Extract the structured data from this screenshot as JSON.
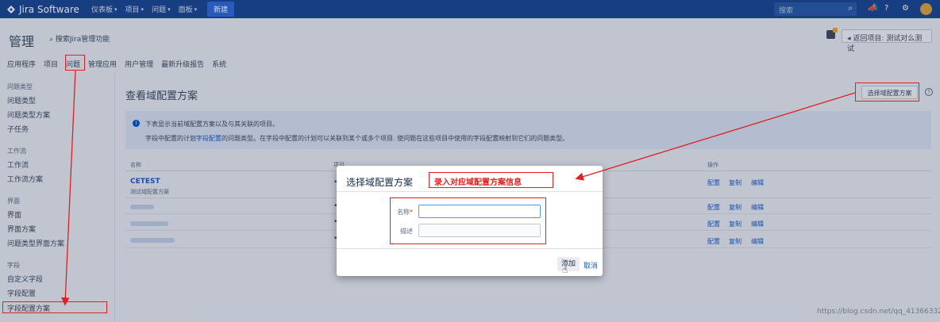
{
  "topbar": {
    "logo": "Jira Software",
    "nav": [
      "仪表板",
      "项目",
      "问题",
      "面板"
    ],
    "create": "新建",
    "search_placeholder": "搜索",
    "icons": [
      "search-icon",
      "notifications-icon",
      "help-icon",
      "settings-icon",
      "avatar"
    ]
  },
  "header": {
    "title": "管理",
    "search_admin": "搜索Jira管理功能",
    "back": "返回项目: 测试对么测试",
    "tabs": [
      "应用程序",
      "项目",
      "问题",
      "管理应用",
      "用户管理",
      "最新升级报告",
      "系统"
    ]
  },
  "sidebar": {
    "groups": [
      {
        "title": "问题类型",
        "items": [
          "问题类型",
          "问题类型方案",
          "子任务"
        ]
      },
      {
        "title": "工作流",
        "items": [
          "工作流",
          "工作流方案"
        ]
      },
      {
        "title": "界面",
        "items": [
          "界面",
          "界面方案",
          "问题类型界面方案"
        ]
      },
      {
        "title": "字段",
        "items": [
          "自定义字段",
          "字段配置",
          "字段配置方案"
        ]
      }
    ]
  },
  "main": {
    "title": "查看域配置方案",
    "select_button": "选择域配置方案",
    "info_line1": "下表显示当前域配置方案以及与其关联的项目。",
    "info_line2_pre": "字段中配置的计划",
    "info_link": "字段配置",
    "info_line2_post": "的问题类型。在字段中配置的计划可以关联到某个或多个项目. 使问题在这些项目中使用的字段配置映射到它们的问题类型。",
    "columns": {
      "name": "名称",
      "projects": "项目",
      "operations": "操作"
    },
    "rows": [
      {
        "name": "CETEST",
        "desc": "测试域配置方案"
      }
    ],
    "ops": {
      "config": "配置",
      "copy": "复制",
      "edit": "编辑"
    }
  },
  "dialog": {
    "title": "选择域配置方案",
    "name_label": "名称",
    "required_mark": "*",
    "desc_label": "描述",
    "name_value": "",
    "desc_value": "",
    "add": "添加",
    "cancel": "取消"
  },
  "annotation": {
    "label": "录入对应域配置方案信息"
  },
  "watermark": "https://blog.csdn.net/qq_41366332"
}
